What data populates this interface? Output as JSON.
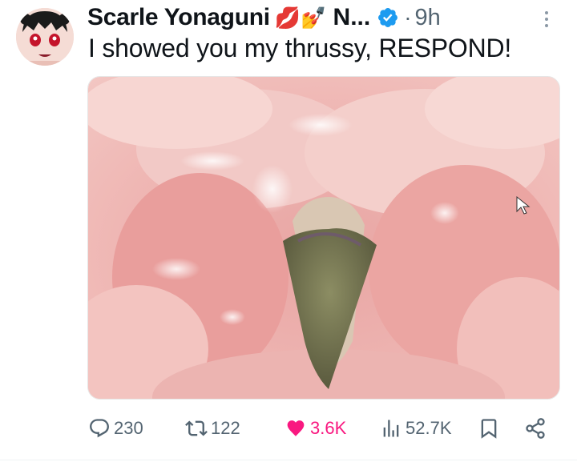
{
  "tweet": {
    "author_name": "Scarle Yonaguni",
    "name_emoji": "💋💅",
    "author_handle_truncated": "N...",
    "separator": "·",
    "time": "9h",
    "text": "I showed you my thrussy, RESPOND!",
    "verified": true
  },
  "actions": {
    "replies": "230",
    "retweets": "122",
    "likes": "3.6K",
    "views": "52.7K",
    "liked": true
  },
  "icons": {
    "reply": "reply-icon",
    "retweet": "retweet-icon",
    "like": "heart-icon",
    "views": "views-icon",
    "bookmark": "bookmark-icon",
    "share": "share-icon",
    "more": "more-icon",
    "verified": "verified-badge-icon"
  },
  "colors": {
    "like": "#f91880",
    "verified": "#1d9bf0",
    "muted": "#536471",
    "text": "#0f1419"
  }
}
